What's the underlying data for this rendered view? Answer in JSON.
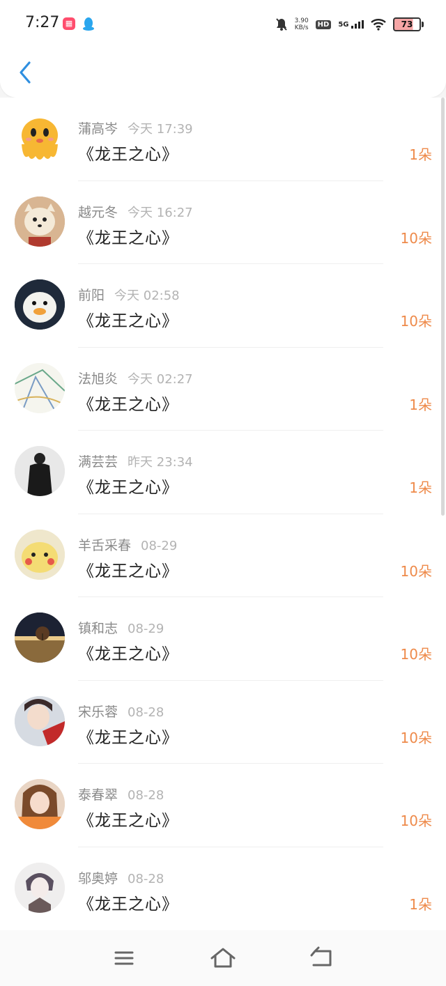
{
  "status_bar": {
    "time": "7:27",
    "net_speed_value": "3.90",
    "net_speed_unit": "KB/s",
    "hd": "HD",
    "network": "5G",
    "battery": "73"
  },
  "header": {
    "back_icon": "chevron-left-icon"
  },
  "colors": {
    "accent": "#2f8fe0",
    "count": "#ee8a4a",
    "name": "#8a8a8a",
    "time": "#b3b3b3"
  },
  "rows": [
    {
      "name": "蒲高岑",
      "time": "今天 17:39",
      "title": "《龙王之心》",
      "count": "1朵"
    },
    {
      "name": "越元冬",
      "time": "今天 16:27",
      "title": "《龙王之心》",
      "count": "10朵"
    },
    {
      "name": "前阳",
      "time": "今天 02:58",
      "title": "《龙王之心》",
      "count": "10朵"
    },
    {
      "name": "法旭炎",
      "time": "今天 02:27",
      "title": "《龙王之心》",
      "count": "1朵"
    },
    {
      "name": "满芸芸",
      "time": "昨天 23:34",
      "title": "《龙王之心》",
      "count": "1朵"
    },
    {
      "name": "羊舌采春",
      "time": "08-29",
      "title": "《龙王之心》",
      "count": "10朵"
    },
    {
      "name": "镇和志",
      "time": "08-29",
      "title": "《龙王之心》",
      "count": "10朵"
    },
    {
      "name": "宋乐蓉",
      "time": "08-28",
      "title": "《龙王之心》",
      "count": "10朵"
    },
    {
      "name": "泰春翠",
      "time": "08-28",
      "title": "《龙王之心》",
      "count": "10朵"
    },
    {
      "name": "邬奥婷",
      "time": "08-28",
      "title": "《龙王之心》",
      "count": "1朵"
    }
  ],
  "nav": {
    "menu_icon": "menu-icon",
    "home_icon": "home-icon",
    "back_icon": "back-icon"
  }
}
